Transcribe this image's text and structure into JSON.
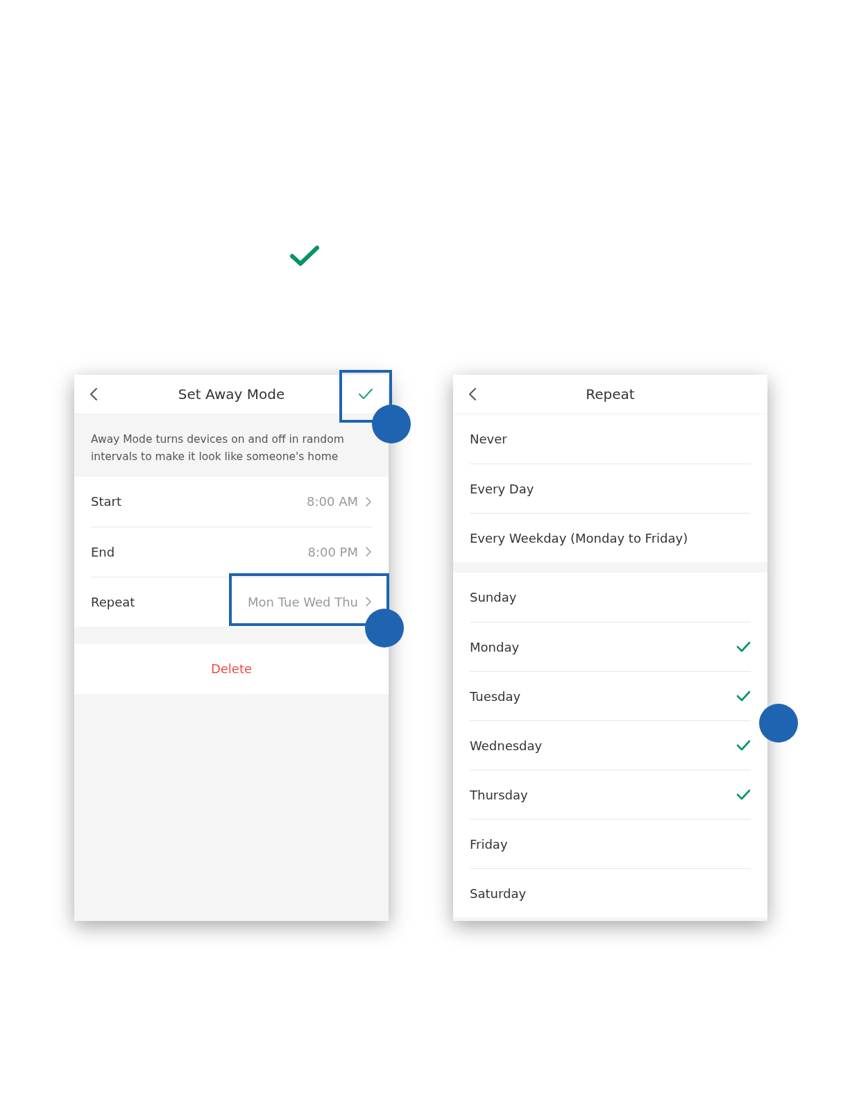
{
  "left_screen": {
    "title": "Set Away Mode",
    "description": "Away Mode turns devices on and off in random intervals to make it look like someone's home",
    "rows": [
      {
        "label": "Start",
        "value": "8:00 AM"
      },
      {
        "label": "End",
        "value": "8:00 PM"
      },
      {
        "label": "Repeat",
        "value": "Mon Tue Wed Thu"
      }
    ],
    "delete": "Delete"
  },
  "right_screen": {
    "title": "Repeat",
    "presets": [
      {
        "label": "Never"
      },
      {
        "label": "Every Day"
      },
      {
        "label": "Every Weekday (Monday to Friday)"
      }
    ],
    "days": [
      {
        "label": "Sunday",
        "checked": false
      },
      {
        "label": "Monday",
        "checked": true
      },
      {
        "label": "Tuesday",
        "checked": true
      },
      {
        "label": "Wednesday",
        "checked": true
      },
      {
        "label": "Thursday",
        "checked": true
      },
      {
        "label": "Friday",
        "checked": false
      },
      {
        "label": "Saturday",
        "checked": false
      }
    ]
  }
}
